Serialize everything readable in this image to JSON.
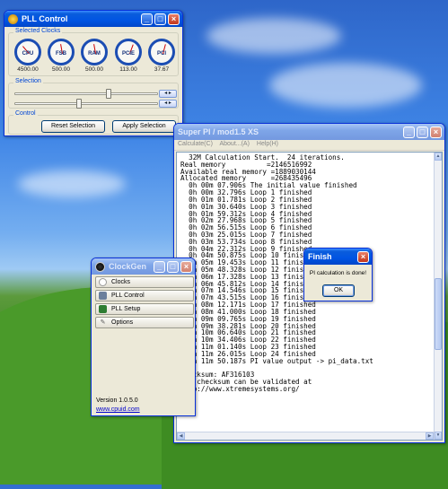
{
  "pll": {
    "title": "PLL Control",
    "groups": {
      "clocks": "Selected Clocks",
      "selection": "Selection",
      "control": "Control"
    },
    "gauges": [
      {
        "name": "CPU",
        "value": "4500.00"
      },
      {
        "name": "FSB",
        "value": "500.00"
      },
      {
        "name": "RAM",
        "value": "500.00"
      },
      {
        "name": "PCIE",
        "value": "113.00"
      },
      {
        "name": "PCI",
        "value": "37.67"
      }
    ],
    "spin_glyph": "◂ ▸",
    "buttons": {
      "reset": "Reset Selection",
      "apply": "Apply Selection"
    }
  },
  "superpi": {
    "title": "Super PI / mod1.5 XS",
    "menu": [
      "Calculate(C)",
      "About...(A)",
      "Help(H)"
    ],
    "lines": [
      "  32M Calculation Start.  24 iterations.",
      "Real memory          =2146516992",
      "Available real memory =1889030144",
      "Allocated memory      =268435496",
      "  0h 00m 07.906s The initial value finished",
      "  0h 00m 32.796s Loop 1 finished",
      "  0h 01m 01.781s Loop 2 finished",
      "  0h 01m 30.640s Loop 3 finished",
      "  0h 01m 59.312s Loop 4 finished",
      "  0h 02m 27.968s Loop 5 finished",
      "  0h 02m 56.515s Loop 6 finished",
      "  0h 03m 25.015s Loop 7 finished",
      "  0h 03m 53.734s Loop 8 finished",
      "  0h 04m 22.312s Loop 9 finished",
      "  0h 04m 50.875s Loop 10 finished",
      "  0h 05m 19.453s Loop 11 finished",
      "  0h 05m 48.328s Loop 12 finished",
      "  0h 06m 17.328s Loop 13 finished",
      "  0h 06m 45.812s Loop 14 finished",
      "  0h 07m 14.546s Loop 15 finished",
      "  0h 07m 43.515s Loop 16 finished",
      "  0h 08m 12.171s Loop 17 finished",
      "  0h 08m 41.000s Loop 18 finished",
      "  0h 09m 09.765s Loop 19 finished",
      "  0h 09m 38.281s Loop 20 finished",
      "  0h 10m 06.640s Loop 21 finished",
      "  0h 10m 34.406s Loop 22 finished",
      "  0h 11m 01.140s Loop 23 finished",
      "  0h 11m 26.015s Loop 24 finished",
      "  0h 11m 50.187s PI value output -> pi_data.txt",
      "",
      "Checksum: AF316103",
      "The checksum can be validated at",
      "http://www.xtremesystems.org/"
    ]
  },
  "finish": {
    "title": "Finish",
    "message": "PI calculation is done!",
    "ok": "OK"
  },
  "clockgen": {
    "title": "ClockGen",
    "items": [
      {
        "label": "Clocks",
        "icon": "clock-icon"
      },
      {
        "label": "PLL Control",
        "icon": "pll-icon"
      },
      {
        "label": "PLL Setup",
        "icon": "chip-icon"
      },
      {
        "label": "Options",
        "icon": "wrench-icon"
      }
    ],
    "version": "Version 1.0.5.0",
    "link": "www.cpuid.com"
  },
  "colors": {
    "xp_title_blue": "#0054e3",
    "close_red": "#c2351a",
    "group_label_blue": "#0046d5"
  }
}
